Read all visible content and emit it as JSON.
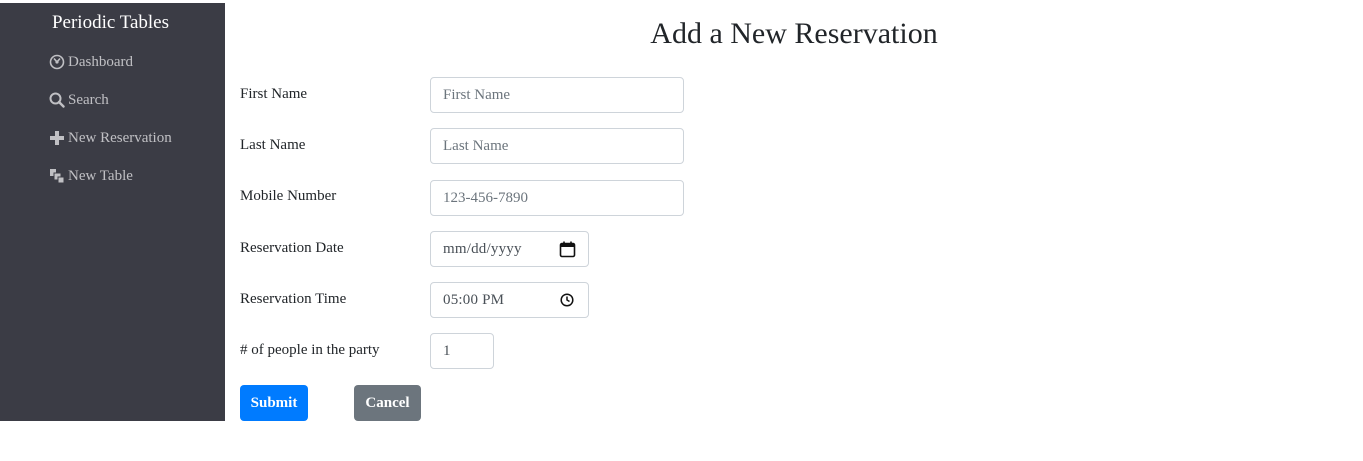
{
  "sidebar": {
    "brand": "Periodic Tables",
    "items": [
      {
        "label": "Dashboard",
        "icon": "dashboard-icon"
      },
      {
        "label": "Search",
        "icon": "search-icon"
      },
      {
        "label": "New Reservation",
        "icon": "plus-icon"
      },
      {
        "label": "New Table",
        "icon": "layers-icon"
      }
    ]
  },
  "page": {
    "title": "Add a New Reservation"
  },
  "form": {
    "first_name": {
      "label": "First Name",
      "placeholder": "First Name"
    },
    "last_name": {
      "label": "Last Name",
      "placeholder": "Last Name"
    },
    "mobile_number": {
      "label": "Mobile Number",
      "placeholder": "123-456-7890"
    },
    "reservation_date": {
      "label": "Reservation Date",
      "value": "mm/dd/yyyy"
    },
    "reservation_time": {
      "label": "Reservation Time",
      "value": "05:00 PM"
    },
    "people": {
      "label": "# of people in the party",
      "value": "1"
    },
    "submit_label": "Submit",
    "cancel_label": "Cancel"
  },
  "colors": {
    "sidebar_bg": "#3b3c45",
    "primary": "#007bff",
    "secondary": "#6c757d"
  }
}
